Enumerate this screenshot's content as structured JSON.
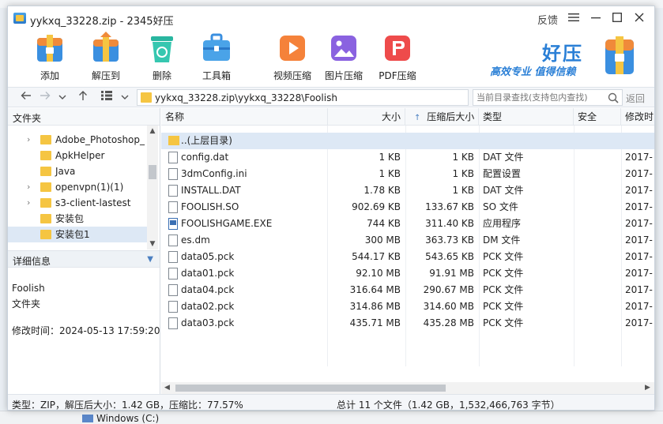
{
  "window": {
    "title": "yykxq_33228.zip - 2345好压",
    "feedback_label": "反馈",
    "menu_icon": "hamburger-icon",
    "minimize_icon": "minimize-icon",
    "maximize_icon": "maximize-icon",
    "close_icon": "close-icon"
  },
  "toolbar": {
    "add": "添加",
    "extract": "解压到",
    "delete": "删除",
    "toolbox": "工具箱",
    "video": "视频压缩",
    "image": "图片压缩",
    "pdf": "PDF压缩"
  },
  "brand": {
    "name": "好压",
    "slogan": "高效专业 值得信赖"
  },
  "address": {
    "path": "yykxq_33228.zip\\yykxq_33228\\Foolish",
    "search_placeholder": "当前目录查找(支持包内查找)",
    "back_label": "返回"
  },
  "left_panel": {
    "header": "文件夹",
    "tree": [
      {
        "label": "Adobe_Photoshop_",
        "expandable": true
      },
      {
        "label": "ApkHelper",
        "expandable": false
      },
      {
        "label": "Java",
        "expandable": false
      },
      {
        "label": "openvpn(1)(1)",
        "expandable": true
      },
      {
        "label": "s3-client-lastest",
        "expandable": true
      },
      {
        "label": "安装包",
        "expandable": false
      },
      {
        "label": "安装包1",
        "expandable": false,
        "selected": true
      }
    ],
    "details_header": "详细信息",
    "details": {
      "name": "Foolish",
      "type": "文件夹",
      "modified": "修改时间：2024-05-13 17:59:20"
    }
  },
  "file_list": {
    "columns": {
      "name": "名称",
      "size": "大小",
      "packed": "压缩后大小",
      "type": "类型",
      "security": "安全",
      "modified": "修改时"
    },
    "sort_icon": "sort-up-arrow-icon",
    "parent_row": "..(上层目录)",
    "rows": [
      {
        "name": "config.dat",
        "size": "1 KB",
        "packed": "1 KB",
        "type": "DAT 文件",
        "modified": "2017-",
        "icon": "file"
      },
      {
        "name": "3dmConfig.ini",
        "size": "1 KB",
        "packed": "1 KB",
        "type": "配置设置",
        "modified": "2017-",
        "icon": "file"
      },
      {
        "name": "INSTALL.DAT",
        "size": "1.78 KB",
        "packed": "1 KB",
        "type": "DAT 文件",
        "modified": "2017-",
        "icon": "file"
      },
      {
        "name": "FOOLISH.SO",
        "size": "902.69 KB",
        "packed": "133.67 KB",
        "type": "SO 文件",
        "modified": "2017-",
        "icon": "file"
      },
      {
        "name": "FOOLISHGAME.EXE",
        "size": "744 KB",
        "packed": "311.40 KB",
        "type": "应用程序",
        "modified": "2017-",
        "icon": "exe"
      },
      {
        "name": "es.dm",
        "size": "300 MB",
        "packed": "363.73 KB",
        "type": "DM 文件",
        "modified": "2017-",
        "icon": "file"
      },
      {
        "name": "data05.pck",
        "size": "544.17 KB",
        "packed": "543.65 KB",
        "type": "PCK 文件",
        "modified": "2017-",
        "icon": "file"
      },
      {
        "name": "data01.pck",
        "size": "92.10 MB",
        "packed": "91.91 MB",
        "type": "PCK 文件",
        "modified": "2017-",
        "icon": "file"
      },
      {
        "name": "data04.pck",
        "size": "316.64 MB",
        "packed": "290.67 MB",
        "type": "PCK 文件",
        "modified": "2017-",
        "icon": "file"
      },
      {
        "name": "data02.pck",
        "size": "314.86 MB",
        "packed": "314.60 MB",
        "type": "PCK 文件",
        "modified": "2017-",
        "icon": "file"
      },
      {
        "name": "data03.pck",
        "size": "435.71 MB",
        "packed": "435.28 MB",
        "type": "PCK 文件",
        "modified": "2017-",
        "icon": "file"
      }
    ]
  },
  "status": {
    "left": "类型：ZIP，解压后大小：1.42 GB，压缩比：77.57%",
    "right": "总计 11 个文件（1.42 GB，1,532,466,763 字节）"
  },
  "background": {
    "drive_label": "Windows (C:)"
  },
  "colors": {
    "accent": "#2a7fd6",
    "selection": "#dde8f5",
    "folder": "#f5c542"
  }
}
